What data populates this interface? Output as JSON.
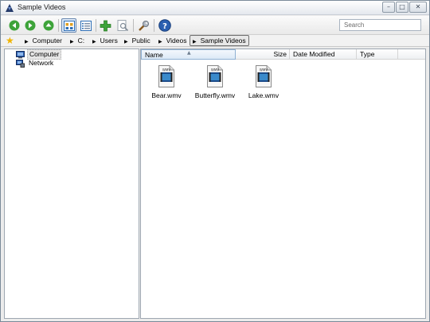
{
  "window": {
    "title": "Sample Videos"
  },
  "titlebar_buttons": {
    "minimize": "–",
    "maximize": "□",
    "close": "✕"
  },
  "toolbar": {
    "buttons": [
      "back-icon",
      "forward-icon",
      "up-icon",
      "large-icons-view-icon",
      "details-view-icon",
      "add-icon",
      "find-icon",
      "tools-icon",
      "help-icon"
    ],
    "search_placeholder": "Search"
  },
  "breadcrumb": {
    "favorite_glyph": "★",
    "arrow": "▶",
    "items": [
      "Computer",
      "C:",
      "Users",
      "Public",
      "Videos",
      "Sample Videos"
    ]
  },
  "tree": {
    "items": [
      {
        "label": "Computer",
        "selected": true
      },
      {
        "label": "Network",
        "selected": false
      }
    ]
  },
  "file_list": {
    "columns": [
      "Name",
      "Size",
      "Date Modified",
      "Type"
    ],
    "sort_caret": "▲",
    "files": [
      {
        "name": "Bear.wmv",
        "badge": "WMV"
      },
      {
        "name": "Butterfly.wmv",
        "badge": "WMV"
      },
      {
        "name": "Lake.wmv",
        "badge": "WMV"
      }
    ]
  },
  "colors": {
    "accent": "#2f6fb6",
    "green": "#3ea33a",
    "star": "#f0b400"
  }
}
